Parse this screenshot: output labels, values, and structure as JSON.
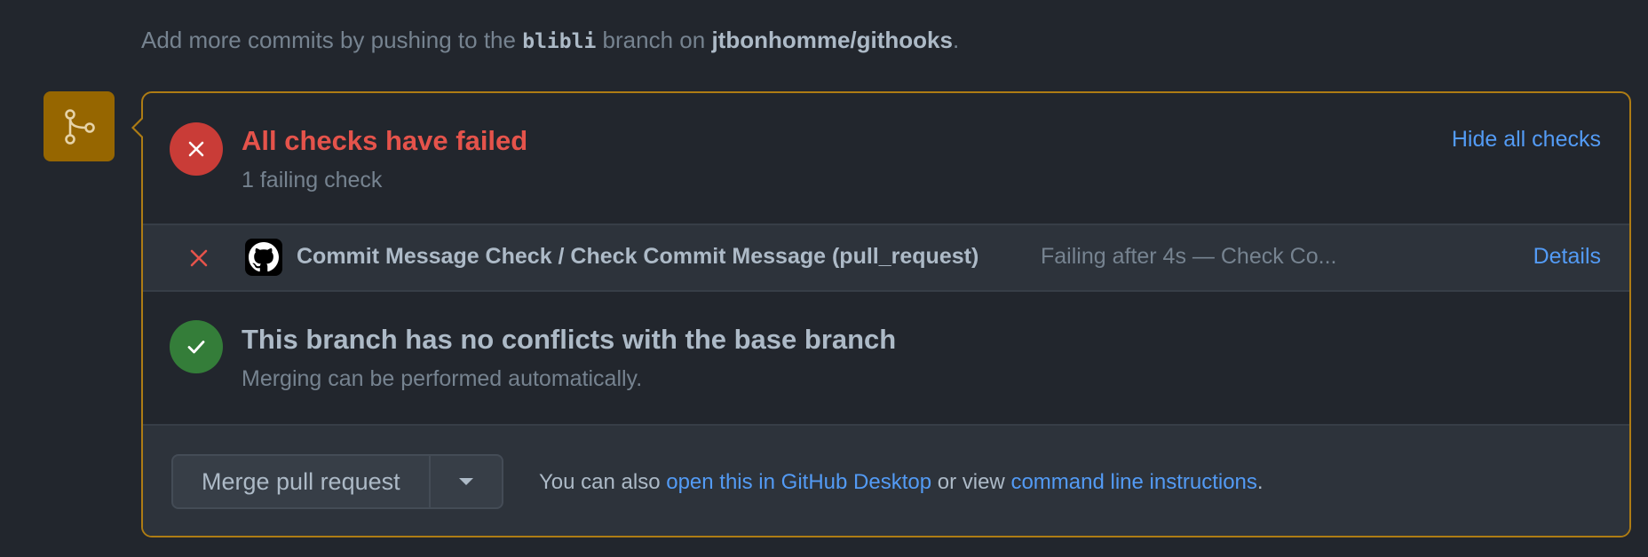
{
  "hint": {
    "prefix": "Add more commits by pushing to the",
    "branch": "blibli",
    "middle": "branch on",
    "repo": "jtbonhomme/githooks",
    "suffix": "."
  },
  "checks": {
    "title": "All checks have failed",
    "subtitle": "1 failing check",
    "toggle_label": "Hide all checks",
    "items": [
      {
        "name": "Commit Message Check / Check Commit Message (pull_request)",
        "status": "Failing after 4s — Check Co...",
        "details_label": "Details"
      }
    ]
  },
  "conflicts": {
    "title": "This branch has no conflicts with the base branch",
    "subtitle": "Merging can be performed automatically."
  },
  "merge": {
    "button_label": "Merge pull request",
    "note_prefix": "You can also",
    "desktop_link": "open this in GitHub Desktop",
    "note_middle": "or view",
    "cli_link": "command line instructions",
    "note_suffix": "."
  },
  "colors": {
    "fail": "#c93c37",
    "success": "#347d39",
    "link": "#539bf5",
    "badge": "#966600",
    "border_accent": "#ae7c14"
  },
  "icons": {
    "badge": "git-merge-icon",
    "fail_status": "x-circle-icon",
    "row_fail": "x-icon",
    "provider": "github-logo-icon",
    "ok_status": "check-circle-icon",
    "dropdown": "triangle-down-icon"
  }
}
